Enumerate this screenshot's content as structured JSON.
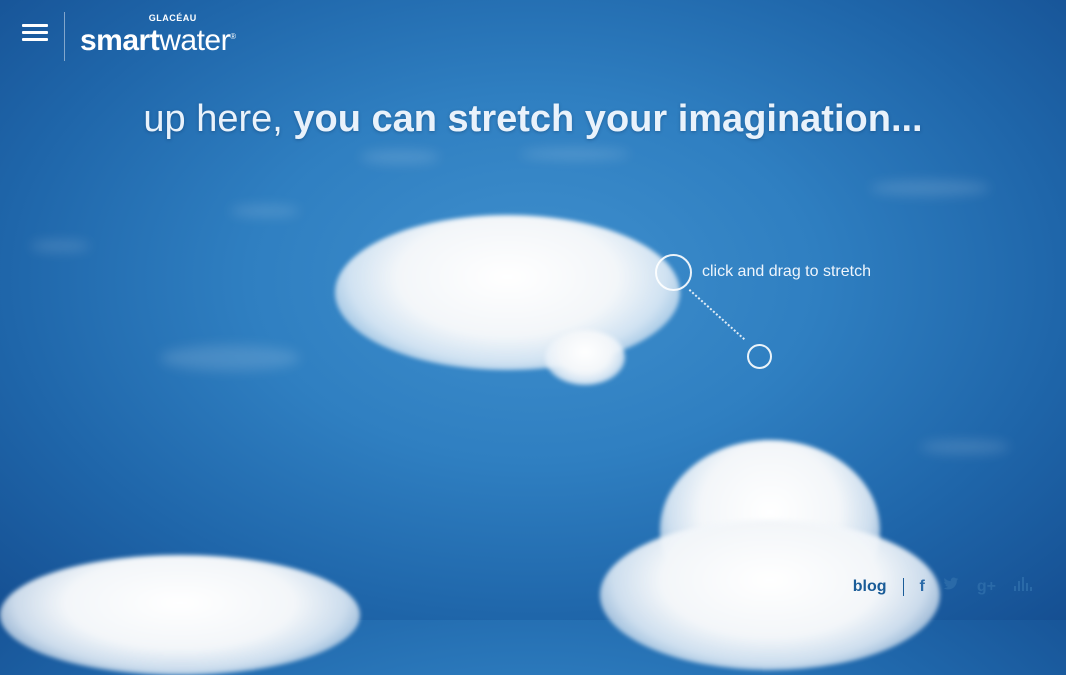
{
  "header": {
    "menu_icon": "hamburger-menu-icon",
    "logo_top": "GLACÉAU",
    "logo_bold": "smart",
    "logo_light": "water",
    "logo_reg": "®"
  },
  "headline": {
    "light_text": "up here,",
    "bold_text": "you can stretch your imagination..."
  },
  "interaction": {
    "hint_text": "click and drag to stretch"
  },
  "footer": {
    "blog_label": "blog",
    "social_icons": [
      "facebook-icon",
      "twitter-icon",
      "google-plus-icon",
      "equalizer-icon"
    ],
    "facebook_glyph": "f",
    "twitter_glyph": "🐦",
    "gplus_glyph": "g+",
    "sound_glyph": "▮"
  },
  "colors": {
    "sky_top": "#1f66aa",
    "sky_center": "#3f8fcd",
    "text_light": "#e9f2fb",
    "footer_blue": "#1a5c98"
  }
}
